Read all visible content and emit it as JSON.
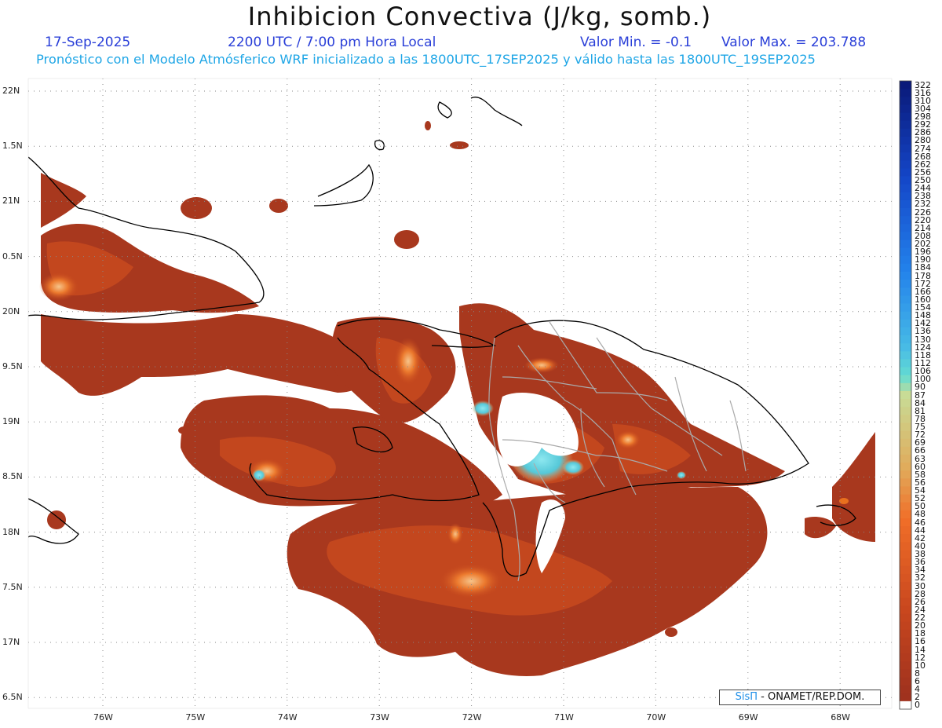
{
  "header": {
    "title": "Inhibicion Convectiva (J/kg, somb.)",
    "date": "17-Sep-2025",
    "time": "2200 UTC / 7:00 pm Hora Local",
    "min_label": "Valor Min. = -0.1",
    "max_label": "Valor Max. = 203.788",
    "model_line": "Pronóstico con el Modelo Atmósferico WRF inicializado a las 1800UTC_17SEP2025 y válido hasta las  1800UTC_19SEP2025"
  },
  "axes": {
    "lat_labels": [
      "22N",
      "1.5N",
      "21N",
      "0.5N",
      "20N",
      "9.5N",
      "19N",
      "8.5N",
      "18N",
      "7.5N",
      "17N",
      "6.5N"
    ],
    "lon_labels": [
      "76W",
      "75W",
      "74W",
      "73W",
      "72W",
      "71W",
      "70W",
      "69W",
      "68W"
    ],
    "lat_range": [
      16.5,
      22.0
    ],
    "lon_range": [
      -76.8,
      -67.6
    ]
  },
  "colorbar": {
    "labels": [
      "322",
      "316",
      "310",
      "304",
      "298",
      "292",
      "286",
      "280",
      "274",
      "268",
      "262",
      "256",
      "250",
      "244",
      "238",
      "232",
      "226",
      "220",
      "214",
      "208",
      "202",
      "196",
      "190",
      "184",
      "178",
      "172",
      "166",
      "160",
      "154",
      "148",
      "142",
      "136",
      "130",
      "124",
      "118",
      "112",
      "106",
      "100",
      "90",
      "87",
      "84",
      "81",
      "78",
      "75",
      "72",
      "69",
      "66",
      "63",
      "60",
      "58",
      "56",
      "54",
      "52",
      "50",
      "48",
      "46",
      "44",
      "42",
      "40",
      "38",
      "36",
      "34",
      "32",
      "30",
      "28",
      "26",
      "24",
      "22",
      "20",
      "18",
      "16",
      "14",
      "12",
      "10",
      "8",
      "6",
      "4",
      "2",
      "0"
    ],
    "colors": {
      "high_dark_blue": "#0a1a7a",
      "blue": "#1e6ee8",
      "light_blue": "#3fb8e8",
      "cyan": "#5fe0d0",
      "pale_yellow": "#d8d890",
      "tan": "#d8b060",
      "orange": "#f06020",
      "dark_red": "#a03020",
      "zero": "#ffffff"
    }
  },
  "field_colors": {
    "base": "#a8381e",
    "mid": "#c84a1e",
    "bright": "#e8641e",
    "highlight": "#f0a060",
    "peak": "#6cd8d8"
  },
  "credit": {
    "brand": "SisΠ",
    "text": " - ONAMET/REP.DOM."
  }
}
